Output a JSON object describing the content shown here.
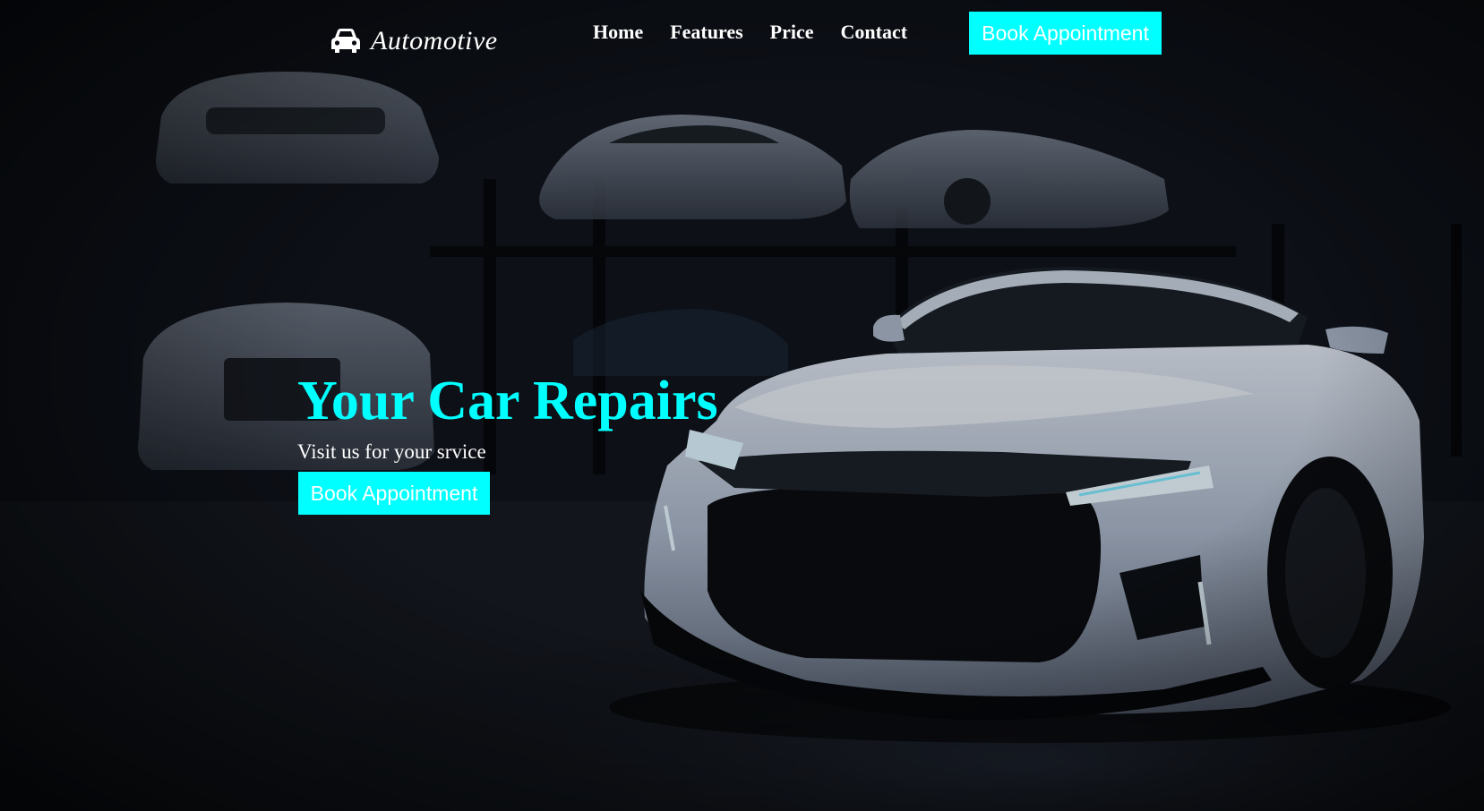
{
  "brand": {
    "name": "Automotive",
    "icon": "car-icon"
  },
  "nav": {
    "links": [
      "Home",
      "Features",
      "Price",
      "Contact"
    ],
    "cta_label": "Book Appointment"
  },
  "hero": {
    "title": "Your Car Repairs",
    "subtitle": "Visit us for your srvice",
    "cta_label": "Book Appointment"
  },
  "colors": {
    "accent": "#00ffff",
    "text": "#ffffff",
    "background": "#0b0e14"
  }
}
